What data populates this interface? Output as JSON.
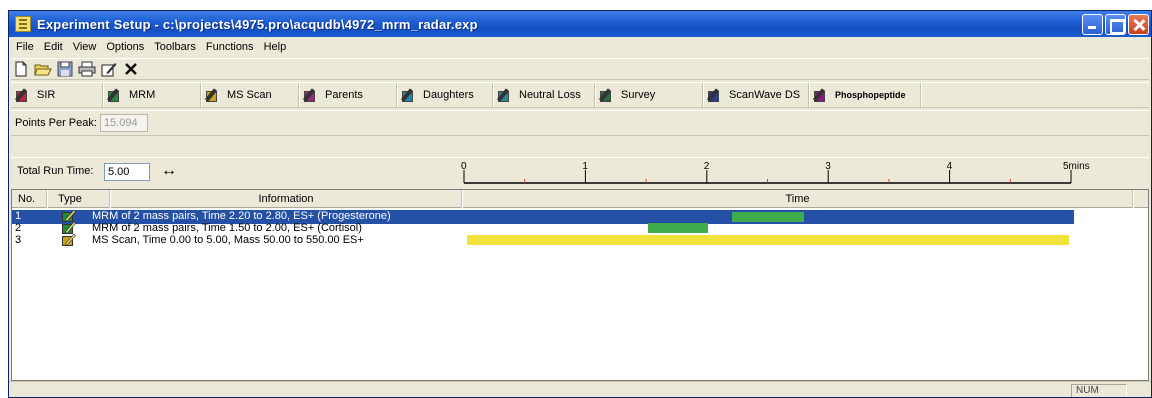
{
  "window": {
    "title": "Experiment Setup - c:\\projects\\4975.pro\\acqudb\\4972_mrm_radar.exp"
  },
  "menu": [
    "File",
    "Edit",
    "View",
    "Options",
    "Toolbars",
    "Functions",
    "Help"
  ],
  "toolbar": {
    "icons": [
      "new-file-icon",
      "open-folder-icon",
      "save-icon",
      "print-icon",
      "edit-icon",
      "delete-icon"
    ]
  },
  "function_toolbar": {
    "items": [
      {
        "label": "SIR",
        "color": "#c0203a"
      },
      {
        "label": "MRM",
        "color": "#1f8a3a"
      },
      {
        "label": "MS Scan",
        "color": "#c8a41c"
      },
      {
        "label": "Parents",
        "color": "#9a2a70"
      },
      {
        "label": "Daughters",
        "color": "#1e86a8"
      },
      {
        "label": "Neutral Loss",
        "color": "#2a8a8a"
      },
      {
        "label": "Survey",
        "color": "#2a6a3a"
      },
      {
        "label": "ScanWave DS",
        "color": "#2a3a9a"
      },
      {
        "label": "Phosphopeptide",
        "color": "#8a1a8a"
      }
    ]
  },
  "points_per_peak": {
    "label": "Points Per Peak:",
    "value": "15.094"
  },
  "run_time": {
    "label": "Total Run Time:",
    "value": "5.00",
    "scale_ticks": [
      "0",
      "1",
      "2",
      "3",
      "4",
      "5mins"
    ]
  },
  "list": {
    "headers": {
      "no": "No.",
      "type": "Type",
      "info": "Information",
      "time": "Time"
    },
    "time_range": [
      0,
      5
    ],
    "rows": [
      {
        "no": "1",
        "info": "MRM of 2 mass pairs, Time 2.20 to 2.80, ES+ (Progesterone)",
        "start": 2.2,
        "end": 2.8,
        "bar_color": "#3eac4a",
        "icon_color": "#1f8a3a",
        "selected": true
      },
      {
        "no": "2",
        "info": "MRM of 2 mass pairs, Time 1.50 to 2.00, ES+ (Cortisol)",
        "start": 1.5,
        "end": 2.0,
        "bar_color": "#3eac4a",
        "icon_color": "#1f8a3a",
        "selected": false
      },
      {
        "no": "3",
        "info": "MS Scan, Time 0.00 to 5.00, Mass 50.00 to 550.00 ES+",
        "start": 0.0,
        "end": 5.0,
        "bar_color": "#f0e23a",
        "icon_color": "#c8a41c",
        "selected": false
      }
    ]
  },
  "status": {
    "num": "NUM"
  }
}
